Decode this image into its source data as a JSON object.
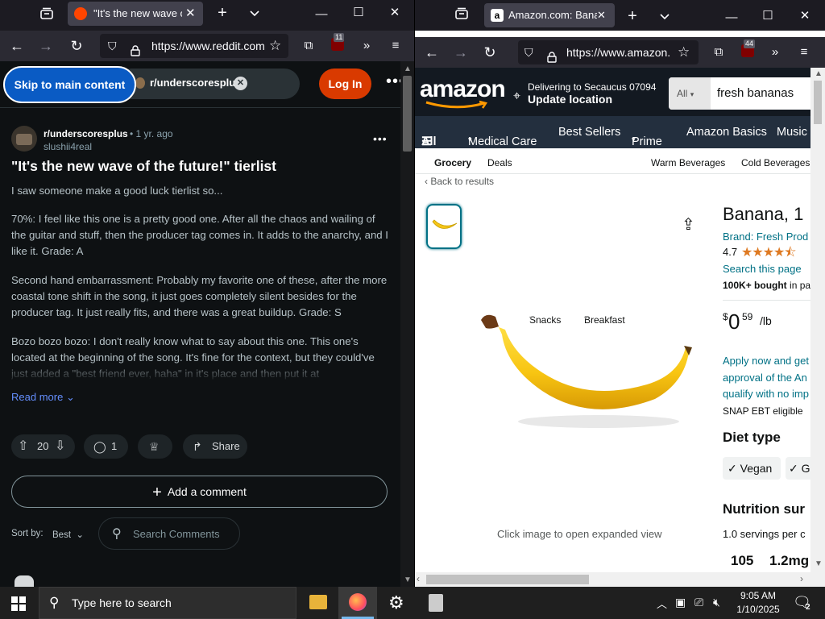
{
  "left_browser": {
    "tab_title": "\"It's the new wave of t",
    "url": "https://www.reddit.com",
    "ext_badge": "11"
  },
  "reddit": {
    "skip_label": "Skip to main content",
    "search_chip": "r/underscoresplus",
    "login_label": "Log In",
    "subreddit": "r/underscoresplus",
    "time": "• 1 yr. ago",
    "author": "slushii4real",
    "title": "\"It's the new wave of the future!\" tierlist",
    "paragraphs": [
      "I saw someone make a good luck tierlist so...",
      "70%: I feel like this one is a pretty good one. After all the chaos and wailing of the guitar and stuff, then the producer tag comes in. It adds to the anarchy, and I like it. Grade: A",
      "Second hand embarrassment: Probably my favorite one of these, after the more coastal tone shift in the song, it just goes completely silent besides for the producer tag. It just really fits, and there was a great buildup. Grade: S",
      "Bozo bozo bozo: I don't really know what to say about this one. This one's located at the beginning of the song. It's fine for the context, but they could've just added a \"best friend ever, haha\" in it's place and then put it at"
    ],
    "read_more": "Read more",
    "votes": "20",
    "comments": "1",
    "share": "Share",
    "add_comment": "Add a comment",
    "sort_label": "Sort by:",
    "sort_value": "Best",
    "search_comments": "Search Comments"
  },
  "right_browser": {
    "tab_title": "Amazon.com: Banan",
    "url": "https://www.amazon.",
    "ext_badge": "44"
  },
  "amazon": {
    "logo": "amazon",
    "deliver_line1": "Delivering to Secaucus 07094",
    "deliver_line2": "Update location",
    "search_cat": "All",
    "search_value": "fresh bananas",
    "nav": [
      "All",
      "Medical Care",
      "Best Sellers",
      "Prime",
      "Amazon Basics",
      "Music"
    ],
    "subnav": [
      "Grocery",
      "Deals",
      "Snacks",
      "Breakfast",
      "Warm Beverages",
      "Cold Beverages"
    ],
    "back": "Back to results",
    "product_title": "Banana, 1",
    "brand": "Brand: Fresh Prod",
    "rating": "4.7",
    "rating_value": 4.7,
    "search_page": "Search this page",
    "bought": "100K+ bought",
    "bought_suffix": "in pa",
    "price_symbol": "$",
    "price_whole": "0",
    "price_frac": "59",
    "price_unit": "/lb",
    "apply": [
      "Apply now and get",
      "approval of the An",
      "qualify with no imp"
    ],
    "snap": "SNAP EBT eligible",
    "diet_heading": "Diet type",
    "diet_chips": [
      "Vegan",
      "Gl"
    ],
    "nutrition_heading": "Nutrition sur",
    "servings": "1.0 servings per c",
    "nutri_values": [
      "105",
      "1.2mg"
    ],
    "click_hint": "Click image to open expanded view"
  },
  "taskbar": {
    "search_placeholder": "Type here to search",
    "time": "9:05 AM",
    "date": "1/10/2025",
    "notif_count": "2"
  },
  "colors": {
    "reddit_login": "#d93a00",
    "skip_btn": "#0a5bc4",
    "amazon_header": "#131921",
    "amazon_nav": "#232f3e",
    "amazon_link": "#007185",
    "price": "#0f1111",
    "star": "#de7921"
  }
}
